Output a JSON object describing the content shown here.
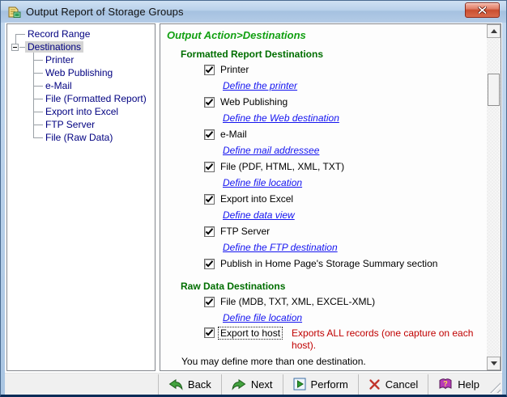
{
  "window": {
    "title": "Output Report of Storage Groups",
    "app_icon": "report-app-icon",
    "close_icon": "close-x-icon"
  },
  "tree": {
    "items": [
      {
        "label": "Record Range",
        "level": 0,
        "selected": false
      },
      {
        "label": "Destinations",
        "level": 0,
        "selected": true,
        "expander": "-"
      },
      {
        "label": "Printer",
        "level": 1
      },
      {
        "label": "Web Publishing",
        "level": 1
      },
      {
        "label": "e-Mail",
        "level": 1
      },
      {
        "label": "File (Formatted Report)",
        "level": 1
      },
      {
        "label": "Export into Excel",
        "level": 1
      },
      {
        "label": "FTP Server",
        "level": 1
      },
      {
        "label": "File (Raw Data)",
        "level": 1
      }
    ]
  },
  "content": {
    "breadcrumb": "Output Action>Destinations",
    "sections": [
      {
        "heading": "Formatted Report Destinations",
        "items": [
          {
            "type": "checkbox",
            "label": "Printer",
            "checked": true
          },
          {
            "type": "link",
            "label": "Define the printer"
          },
          {
            "type": "checkbox",
            "label": "Web Publishing",
            "checked": true
          },
          {
            "type": "link",
            "label": "Define the Web destination"
          },
          {
            "type": "checkbox",
            "label": "e-Mail",
            "checked": true
          },
          {
            "type": "link",
            "label": "Define mail addressee"
          },
          {
            "type": "checkbox",
            "label": "File (PDF, HTML, XML, TXT)",
            "checked": true
          },
          {
            "type": "link",
            "label": "Define file location"
          },
          {
            "type": "checkbox",
            "label": "Export into Excel",
            "checked": true
          },
          {
            "type": "link",
            "label": "Define data view"
          },
          {
            "type": "checkbox",
            "label": "FTP Server",
            "checked": true
          },
          {
            "type": "link",
            "label": "Define the FTP destination"
          },
          {
            "type": "checkbox",
            "label": "Publish in Home Page's Storage Summary section",
            "checked": true
          }
        ]
      },
      {
        "heading": "Raw Data Destinations",
        "items": [
          {
            "type": "checkbox",
            "label": "File (MDB, TXT, XML, EXCEL-XML)",
            "checked": true
          },
          {
            "type": "link",
            "label": "Define file location"
          },
          {
            "type": "checkbox",
            "label": "Export to host",
            "checked": true,
            "focused": true,
            "note": "Exports ALL records (one capture on each host)."
          }
        ]
      }
    ],
    "footer_note": "You may define more than one destination."
  },
  "scrollbar": {
    "up_icon": "scroll-up-arrow-icon",
    "down_icon": "scroll-down-arrow-icon"
  },
  "footer": {
    "buttons": [
      {
        "label": "Back",
        "icon": "back-arrow-icon"
      },
      {
        "label": "Next",
        "icon": "next-arrow-icon"
      },
      {
        "label": "Perform",
        "icon": "perform-play-icon"
      },
      {
        "label": "Cancel",
        "icon": "cancel-x-icon"
      },
      {
        "label": "Help",
        "icon": "help-book-icon"
      }
    ]
  },
  "colors": {
    "breadcrumb_green": "#12a012",
    "heading_green": "#006e00",
    "link_blue": "#1414f0",
    "tree_navy": "#000080",
    "note_red": "#c00000",
    "check_black": "#000000"
  }
}
